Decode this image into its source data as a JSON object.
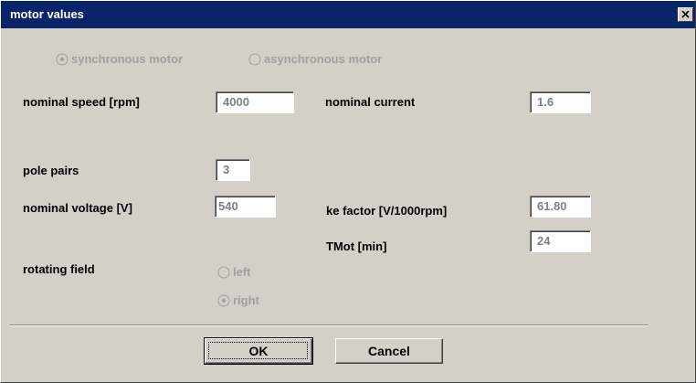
{
  "window": {
    "title": "motor values"
  },
  "motor_type": {
    "options": [
      {
        "label": "synchronous motor",
        "selected": true,
        "enabled": false
      },
      {
        "label": "asynchronous motor",
        "selected": false,
        "enabled": false
      }
    ]
  },
  "fields": {
    "nominal_speed": {
      "label": "nominal speed [rpm]",
      "value": "4000"
    },
    "nominal_current": {
      "label": "nominal current",
      "value": "1.6"
    },
    "pole_pairs": {
      "label": "pole pairs",
      "value": "3"
    },
    "nominal_voltage": {
      "label": "nominal voltage [V]",
      "value": "540"
    },
    "ke_factor": {
      "label": "ke factor [V/1000rpm]",
      "value": "61.80"
    },
    "tmot": {
      "label": "TMot [min]",
      "value": "24"
    }
  },
  "rotating_field": {
    "label": "rotating field",
    "options": [
      {
        "label": "left",
        "selected": false,
        "enabled": false
      },
      {
        "label": "right",
        "selected": true,
        "enabled": false
      }
    ]
  },
  "buttons": {
    "ok": "OK",
    "cancel": "Cancel"
  },
  "colors": {
    "title_bar": "#0a246a",
    "dialog_bg": "#d4d0c8",
    "disabled_text": "#a0a0a0",
    "field_text": "#808080"
  }
}
